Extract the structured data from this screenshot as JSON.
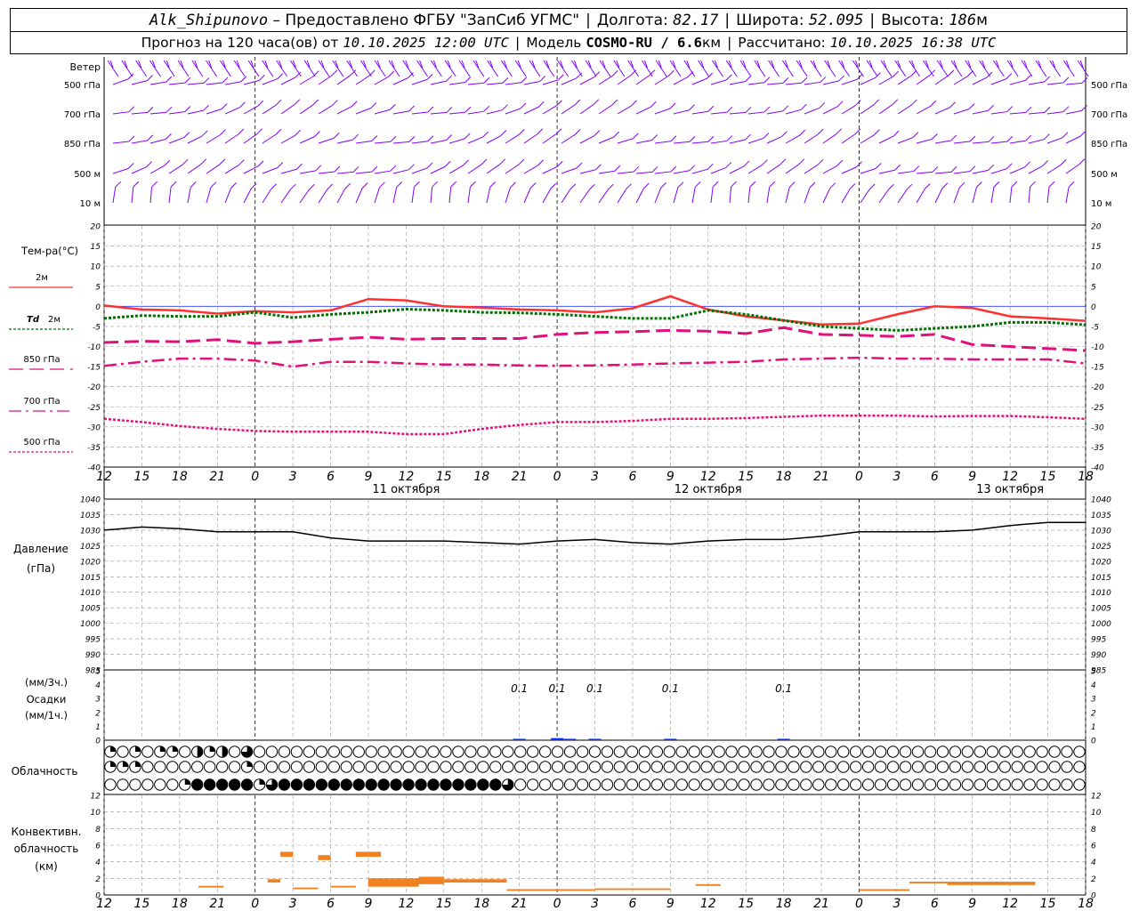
{
  "header": {
    "station": "Alk_Shipunovo",
    "provider": "– Предоставлено ФГБУ \"ЗапСиб УГМС\"",
    "lon_label": "Долгота:",
    "lon": "82.17",
    "lat_label": "Широта:",
    "lat": "52.095",
    "alt_label": "Высота:",
    "alt": "186",
    "alt_unit": "м"
  },
  "subheader": {
    "forecast_label": "Прогноз на 120 часа(ов) от",
    "forecast_date": "10.10.2025 12:00 UTC",
    "model_label": "Модель",
    "model": "COSMO-RU / 6.6",
    "model_unit": "км",
    "calc_label": "Рассчитано:",
    "calc_date": "10.10.2025 16:38 UTC"
  },
  "labels": {
    "wind": "Ветер",
    "wind_levels": [
      "500 гПа",
      "700 гПа",
      "850 гПа",
      "500 м",
      "10 м"
    ],
    "temp_title": "Тем-ра(°C)",
    "legend": {
      "t2m": "2м",
      "td": "Td",
      "td2": "2м",
      "t850": "850 гПа",
      "t700": "700 гПа",
      "t500": "500 гПа"
    },
    "pressure": "Давление",
    "pressure_unit": "(гПа)",
    "precip_top": "(мм/3ч.)",
    "precip": "Осадки",
    "precip_bottom": "(мм/1ч.)",
    "cloud": "Облачность",
    "conv1": "Конвективн.",
    "conv2": "облачность",
    "conv3": "(км)"
  },
  "colors": {
    "wind": "#7f00ff",
    "t2m": "#ff3030",
    "td": "#007000",
    "t850": "#e0107a",
    "precip": "#0030ff",
    "conv": "#f08020",
    "grid": "#999999"
  },
  "chart_data": {
    "type": "line",
    "x_hours": [
      0,
      3,
      6,
      9,
      12,
      15,
      18,
      21,
      24,
      27,
      30,
      33,
      36,
      39,
      42,
      45,
      48,
      51,
      54,
      57,
      60,
      63,
      66,
      69,
      72,
      75,
      78
    ],
    "x_tick_labels": [
      "12",
      "15",
      "18",
      "21",
      "0",
      "3",
      "6",
      "9",
      "12",
      "15",
      "18",
      "21",
      "0",
      "3",
      "6",
      "9",
      "12",
      "15",
      "18",
      "21",
      "0",
      "3",
      "6",
      "9",
      "12",
      "15",
      "18"
    ],
    "date_labels": [
      {
        "hour": 24,
        "text": "11 октября"
      },
      {
        "hour": 48,
        "text": "12 октября"
      },
      {
        "hour": 72,
        "text": "13 октября"
      }
    ],
    "temperature": {
      "ylim": [
        -40,
        20
      ],
      "yticks": [
        20,
        15,
        10,
        5,
        0,
        -5,
        -10,
        -15,
        -20,
        -25,
        -30,
        -35,
        -40
      ],
      "series": [
        {
          "key": "t2m",
          "values": [
            0.2,
            -0.8,
            -1,
            -1.8,
            -1.2,
            -1.5,
            -1,
            1.8,
            1.5,
            0,
            -0.3,
            -0.8,
            -1,
            -1.5,
            -0.5,
            2.5,
            -0.8,
            -2.5,
            -3.5,
            -4.5,
            -4.3,
            -2,
            0,
            -0.4,
            -2.5,
            -3,
            -3.6
          ]
        },
        {
          "key": "td",
          "values": [
            -3,
            -2.3,
            -2.5,
            -2.5,
            -1.5,
            -2.8,
            -2,
            -1.5,
            -0.7,
            -1,
            -1.5,
            -1.6,
            -2,
            -2.5,
            -3,
            -3,
            -1,
            -2,
            -3.5,
            -5,
            -5.5,
            -6,
            -5.5,
            -5,
            -4,
            -4,
            -4.6
          ]
        },
        {
          "key": "t850",
          "values": [
            -9,
            -8.7,
            -8.8,
            -8.3,
            -9.2,
            -8.8,
            -8.2,
            -7.7,
            -8.2,
            -8,
            -8,
            -8,
            -7,
            -6.5,
            -6.3,
            -6,
            -6.2,
            -6.8,
            -5.3,
            -7,
            -7.2,
            -7.5,
            -7,
            -9.5,
            -10,
            -10.5,
            -11
          ]
        },
        {
          "key": "t700",
          "values": [
            -14.8,
            -13.8,
            -13,
            -13,
            -13.5,
            -15,
            -13.8,
            -13.8,
            -14.2,
            -14.5,
            -14.5,
            -14.7,
            -14.8,
            -14.7,
            -14.5,
            -14.2,
            -14,
            -13.8,
            -13.2,
            -13,
            -12.8,
            -13,
            -13,
            -13.2,
            -13.2,
            -13.2,
            -14.2
          ]
        },
        {
          "key": "t500",
          "values": [
            -28,
            -28.8,
            -29.8,
            -30.5,
            -31,
            -31.2,
            -31.2,
            -31.2,
            -31.8,
            -31.8,
            -30.5,
            -29.5,
            -28.8,
            -28.8,
            -28.5,
            -28,
            -28,
            -27.8,
            -27.5,
            -27.2,
            -27.2,
            -27.2,
            -27.4,
            -27.3,
            -27.3,
            -27.6,
            -28
          ]
        }
      ]
    },
    "pressure": {
      "ylim": [
        985,
        1040
      ],
      "yticks": [
        1040,
        1035,
        1030,
        1025,
        1020,
        1015,
        1010,
        1005,
        1000,
        995,
        990,
        985
      ],
      "values": [
        1030,
        1031,
        1030.5,
        1029.5,
        1029.5,
        1029.5,
        1027.5,
        1026.5,
        1026.5,
        1026.5,
        1026,
        1025.5,
        1026.5,
        1027,
        1026,
        1025.5,
        1026.5,
        1027,
        1027,
        1028,
        1029.5,
        1029.5,
        1029.5,
        1030,
        1031.5,
        1032.5,
        1032.5
      ]
    },
    "precip": {
      "ylim": [
        0,
        5
      ],
      "yticks": [
        5,
        4,
        3,
        2,
        1,
        0
      ],
      "labels": [
        {
          "hour": 33,
          "text": "0.1"
        },
        {
          "hour": 36,
          "text": "0.1"
        },
        {
          "hour": 39,
          "text": "0.1"
        },
        {
          "hour": 45,
          "text": "0.1"
        },
        {
          "hour": 54,
          "text": "0.1"
        }
      ],
      "bars": [
        [
          33,
          0.1
        ],
        [
          36,
          0.15
        ],
        [
          37,
          0.1
        ],
        [
          39,
          0.1
        ],
        [
          45,
          0.1
        ],
        [
          54,
          0.1
        ]
      ]
    },
    "clouds": {
      "rows": [
        "10101102120300000000000000000000000000000000000000000000000000000000000000000000",
        "11100000000100000000000000000000000000000000000000000000000000000000000000000000",
        "00000014444413444444444444444444300000000000000000000000000000000000000000000000"
      ]
    },
    "convective": {
      "ylim": [
        0,
        12
      ],
      "yticks": [
        12,
        10,
        8,
        6,
        4,
        2,
        0
      ],
      "blocks": [
        [
          7.5,
          9.5,
          0.9,
          1.1
        ],
        [
          13,
          14,
          1.5,
          1.9
        ],
        [
          14,
          15,
          4.6,
          5.2
        ],
        [
          15,
          17,
          0.7,
          0.9
        ],
        [
          17,
          18,
          4.2,
          4.8
        ],
        [
          18,
          20,
          0.9,
          1.1
        ],
        [
          20,
          22,
          4.6,
          5.2
        ],
        [
          21,
          25,
          1.0,
          2.0
        ],
        [
          25,
          27,
          1.3,
          2.2
        ],
        [
          27,
          29,
          1.5,
          1.9
        ],
        [
          29,
          32,
          1.5,
          1.9
        ],
        [
          32,
          37,
          0.5,
          0.7
        ],
        [
          37,
          39,
          0.5,
          0.7
        ],
        [
          39,
          45,
          0.6,
          0.8
        ],
        [
          47,
          49,
          1.1,
          1.3
        ],
        [
          60,
          64,
          0.5,
          0.7
        ],
        [
          64,
          67,
          1.4,
          1.6
        ],
        [
          67,
          74,
          1.2,
          1.6
        ]
      ]
    }
  }
}
